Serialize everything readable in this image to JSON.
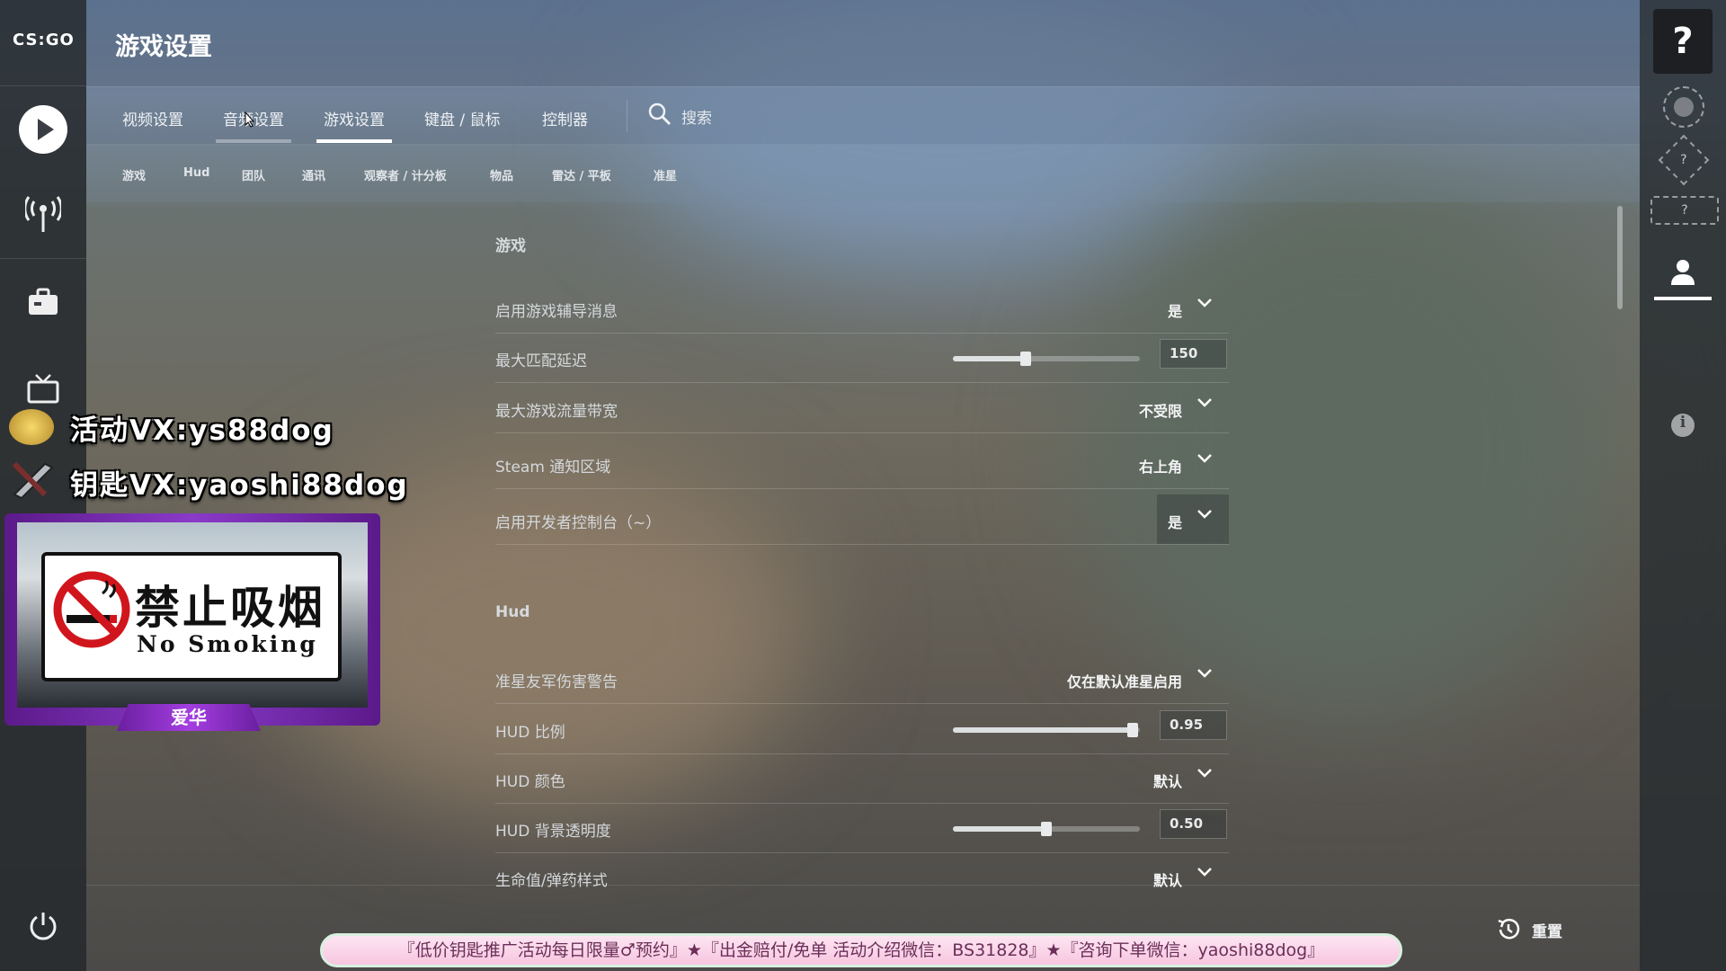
{
  "app": {
    "logo_text": "CS:GO",
    "page_title": "游戏设置"
  },
  "main_tabs": [
    {
      "label": "视频设置"
    },
    {
      "label": "音频设置"
    },
    {
      "label": "游戏设置",
      "active": true
    },
    {
      "label": "键盘 / 鼠标"
    },
    {
      "label": "控制器"
    }
  ],
  "search": {
    "label": "搜索"
  },
  "sub_tabs": [
    "游戏",
    "Hud",
    "团队",
    "通讯",
    "观察者 / 计分板",
    "物品",
    "雷达 / 平板",
    "准星"
  ],
  "sections": [
    {
      "title": "游戏",
      "rows": [
        {
          "label": "启用游戏辅导消息",
          "type": "dropdown",
          "value": "是"
        },
        {
          "label": "最大匹配延迟",
          "type": "slider",
          "value": "150",
          "fill": 0.39
        },
        {
          "label": "最大游戏流量带宽",
          "type": "dropdown",
          "value": "不受限"
        },
        {
          "label": "Steam 通知区域",
          "type": "dropdown",
          "value": "右上角"
        },
        {
          "label": "启用开发者控制台（~）",
          "type": "dropdown",
          "value": "是"
        }
      ]
    },
    {
      "title": "Hud",
      "rows": [
        {
          "label": "准星友军伤害警告",
          "type": "dropdown",
          "value": "仅在默认准星启用"
        },
        {
          "label": "HUD 比例",
          "type": "slider",
          "value": "0.95",
          "fill": 0.96
        },
        {
          "label": "HUD 颜色",
          "type": "dropdown",
          "value": "默认"
        },
        {
          "label": "HUD 背景透明度",
          "type": "slider",
          "value": "0.50",
          "fill": 0.5
        },
        {
          "label": "生命值/弹药样式",
          "type": "dropdown",
          "value": "默认"
        }
      ]
    }
  ],
  "reset": {
    "label": "重置"
  },
  "overlay": {
    "promo_line1": "活动VX:ys88dog",
    "promo_line2": "钥匙VX:yaoshi88dog",
    "sign_cn": "禁止吸烟",
    "sign_en": "No Smoking",
    "streamer_name": "爱华",
    "ticker": "『低价钥匙推广活动每日限量♂预约』★『出金赔付/免单 活动介绍微信：BS31828』★『咨询下单微信：yaoshi88dog』"
  },
  "colors": {
    "accent_underline": "#ffffff",
    "panel": "#26292e"
  }
}
